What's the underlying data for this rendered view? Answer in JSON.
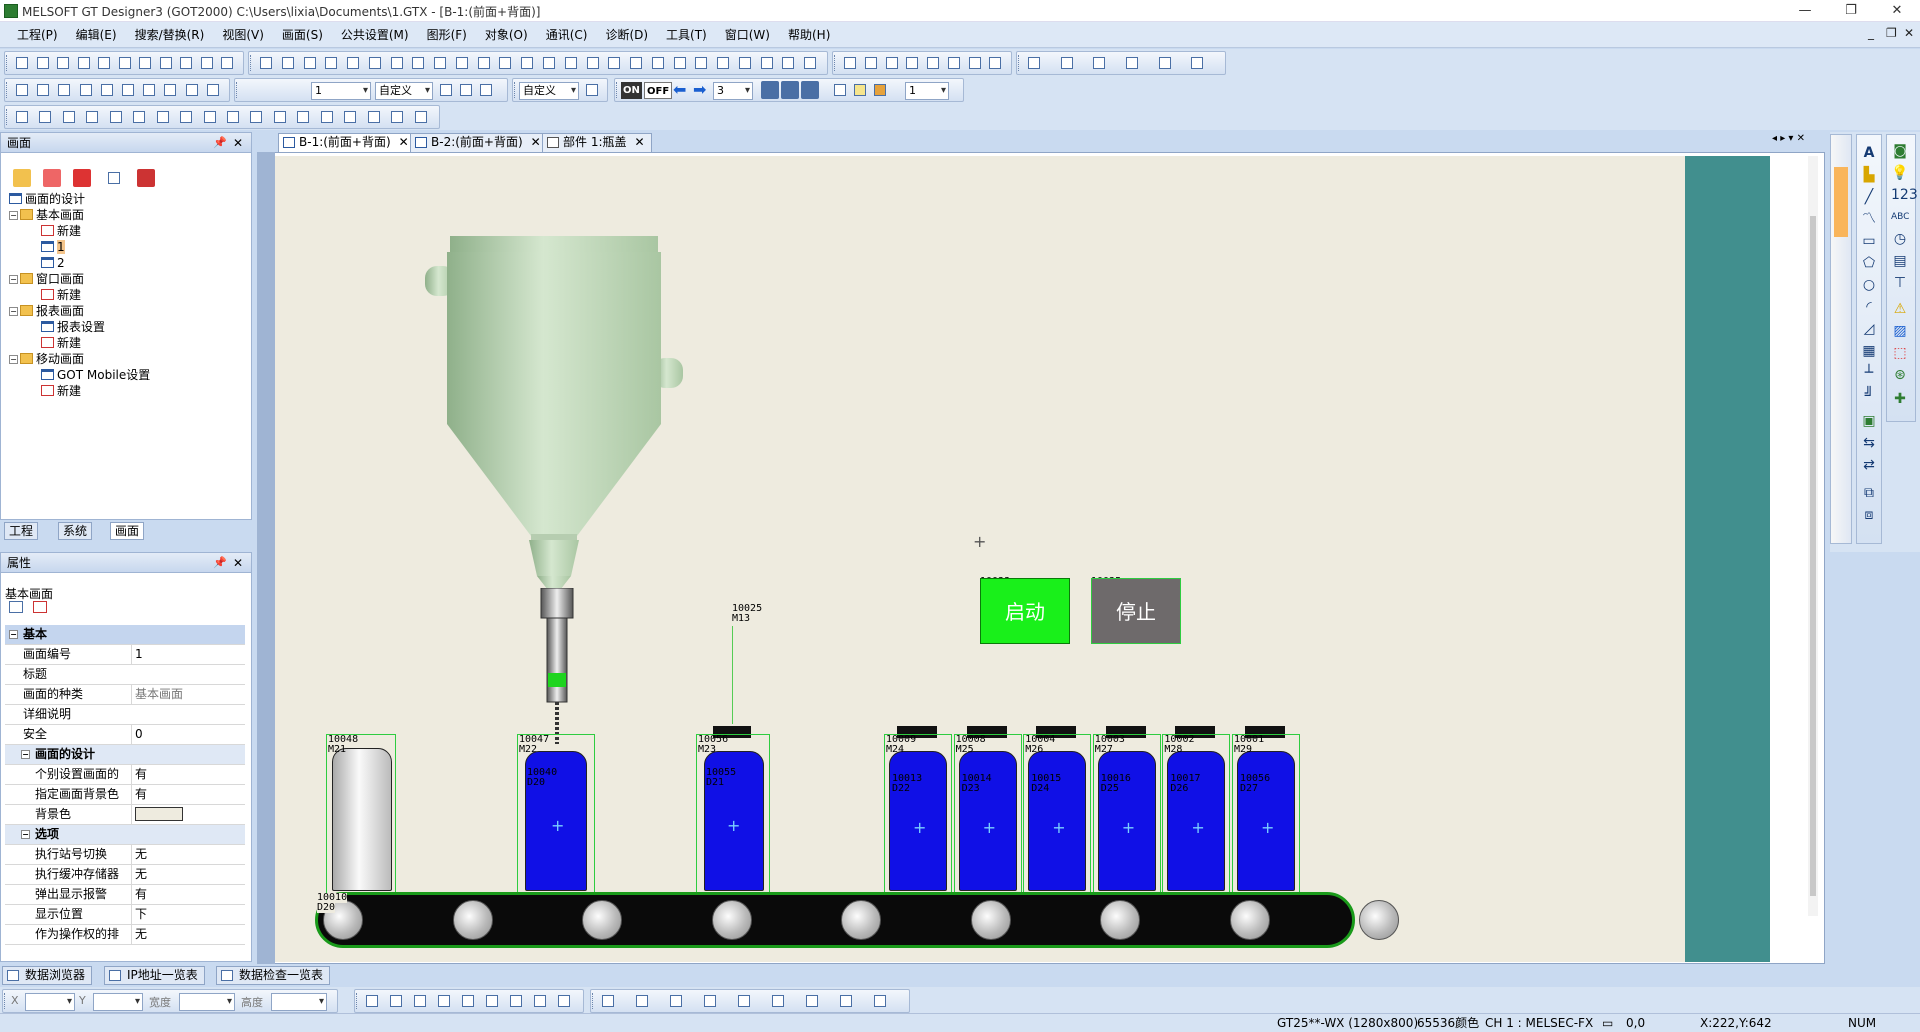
{
  "app": {
    "title": "MELSOFT GT Designer3 (GOT2000) C:\\Users\\lixia\\Documents\\1.GTX - [B-1:(前面+背面)]",
    "win_controls": [
      "—",
      "❐",
      "✕"
    ],
    "mdi_controls": [
      "_",
      "❐",
      "✕"
    ]
  },
  "menu": [
    "工程(P)",
    "编辑(E)",
    "搜索/替换(R)",
    "视图(V)",
    "画面(S)",
    "公共设置(M)",
    "图形(F)",
    "对象(O)",
    "通讯(C)",
    "诊断(D)",
    "工具(T)",
    "窗口(W)",
    "帮助(H)"
  ],
  "toolbar": {
    "screen_no": "1",
    "zoom_mode": "自定义",
    "custom_label": "自定义",
    "on_label": "ON",
    "off_label": "OFF",
    "step": "3",
    "layer": "1"
  },
  "screen_panel": {
    "title": "画面",
    "pin": "📌",
    "close": "✕",
    "tree": {
      "design": "画面的设计",
      "basic": "基本画面",
      "basic_new": "新建",
      "basic_1": "1",
      "basic_2": "2",
      "window": "窗口画面",
      "window_new": "新建",
      "report": "报表画面",
      "report_setting": "报表设置",
      "report_new": "新建",
      "mobile": "移动画面",
      "mobile_setting": "GOT Mobile设置",
      "mobile_new": "新建"
    },
    "tabs": [
      "工程",
      "系统",
      "画面"
    ]
  },
  "prop_panel": {
    "title": "属性",
    "subject": "基本画面",
    "rows": [
      {
        "k": "基本",
        "v": "",
        "t": "cat"
      },
      {
        "k": "画面编号",
        "v": "1",
        "t": "row"
      },
      {
        "k": "标题",
        "v": "",
        "t": "row"
      },
      {
        "k": "画面的种类",
        "v": "基本画面",
        "t": "gray"
      },
      {
        "k": "详细说明",
        "v": "",
        "t": "row"
      },
      {
        "k": "安全",
        "v": "0",
        "t": "row"
      },
      {
        "k": "画面的设计",
        "v": "",
        "t": "sub"
      },
      {
        "k": "个别设置画面的",
        "v": "有",
        "t": "ind"
      },
      {
        "k": "指定画面背景色",
        "v": "有",
        "t": "ind"
      },
      {
        "k": "背景色",
        "v": "",
        "t": "color"
      },
      {
        "k": "选项",
        "v": "",
        "t": "sub"
      },
      {
        "k": "执行站号切换",
        "v": "无",
        "t": "ind"
      },
      {
        "k": "执行缓冲存储器",
        "v": "无",
        "t": "ind"
      },
      {
        "k": "弹出显示报警",
        "v": "有",
        "t": "ind"
      },
      {
        "k": "显示位置",
        "v": "下",
        "t": "ind"
      },
      {
        "k": "作为操作权的排",
        "v": "无",
        "t": "ind"
      }
    ]
  },
  "doc_tabs": [
    "B-1:(前面+背面)",
    "B-2:(前面+背面)",
    "部件 1:瓶盖"
  ],
  "bottom_tabs": [
    "数据浏览器",
    "IP地址一览表",
    "数据检查一览表"
  ],
  "bottom_fields": {
    "x": "X",
    "y": "Y",
    "w": "宽度",
    "h": "高度"
  },
  "status": {
    "model": "GT25**-WX (1280x800)",
    "colors": "65536颜色",
    "channel": "CH 1 : MELSEC-FX",
    "offset": "0,0",
    "cursor": "X:222,Y:642",
    "num": "NUM"
  },
  "hmi": {
    "start_btn": {
      "label": "启动",
      "tag1": "10033",
      "tag2": "M0"
    },
    "stop_btn": {
      "label": "停止",
      "tag1": "10035",
      "tag2": "M1"
    },
    "sensor": {
      "tag1": "10025",
      "tag2": "M13"
    },
    "conveyor": {
      "tag1": "10010",
      "tag2": "D20"
    },
    "empty_bottle": {
      "tag1": "10048",
      "tag2": "M21"
    },
    "fill_bottle": {
      "tag1": "10047",
      "tag2": "M22",
      "lvl1": "10040",
      "lvl2": "D20"
    },
    "cap_bottle": {
      "tag1": "10056",
      "tag2": "M23",
      "lvl1": "10055",
      "lvl2": "D21"
    },
    "row_bottles": [
      {
        "tag1": "10009",
        "tag2": "M24",
        "lvl1": "10013",
        "lvl2": "D22"
      },
      {
        "tag1": "10008",
        "tag2": "M25",
        "lvl1": "10014",
        "lvl2": "D23"
      },
      {
        "tag1": "10004",
        "tag2": "M26",
        "lvl1": "10015",
        "lvl2": "D24"
      },
      {
        "tag1": "10003",
        "tag2": "M27",
        "lvl1": "10016",
        "lvl2": "D25"
      },
      {
        "tag1": "10002",
        "tag2": "M28",
        "lvl1": "10017",
        "lvl2": "D26"
      },
      {
        "tag1": "10001",
        "tag2": "M29",
        "lvl1": "10056",
        "lvl2": "D27"
      }
    ]
  },
  "colors": {
    "start": "#19f01a",
    "stop": "#6e6a6b",
    "bottle_fill": "#1010e6",
    "canvas": "#eeebdf",
    "teal": "#418f8e",
    "tank": "#c8ddc4"
  }
}
